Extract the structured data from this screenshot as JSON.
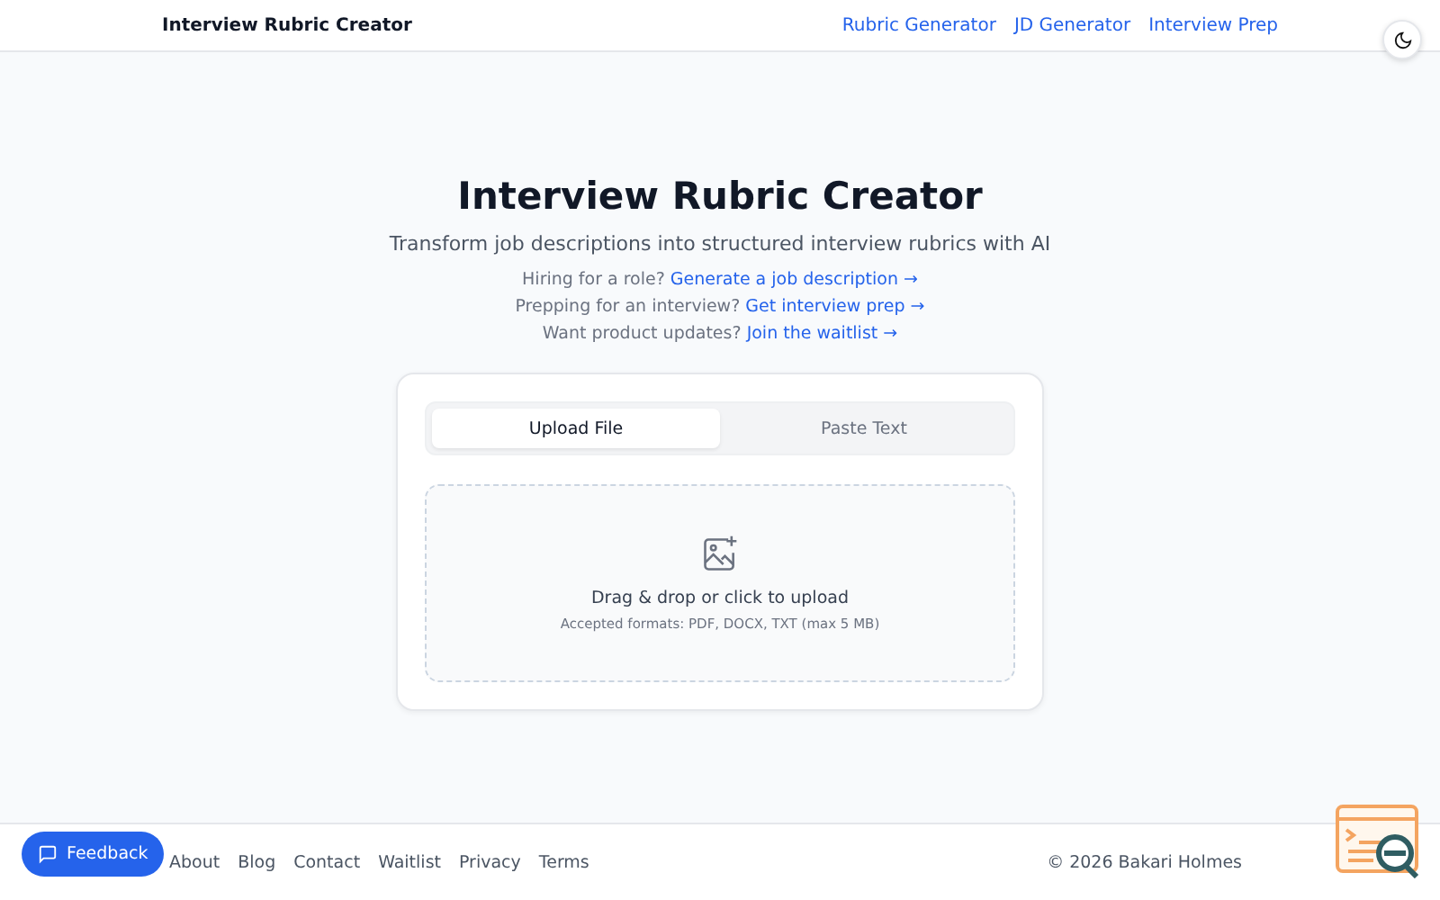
{
  "header": {
    "brand": "Interview Rubric Creator",
    "nav": [
      "Rubric Generator",
      "JD Generator",
      "Interview Prep"
    ]
  },
  "hero": {
    "title": "Interview Rubric Creator",
    "subtitle": "Transform job descriptions into structured interview rubrics with AI",
    "promos": [
      {
        "text": "Hiring for a role?",
        "link": "Generate a job description →"
      },
      {
        "text": "Prepping for an interview?",
        "link": "Get interview prep →"
      },
      {
        "text": "Want product updates?",
        "link": "Join the waitlist →"
      }
    ]
  },
  "tabs": [
    {
      "label": "Upload File",
      "selected": true
    },
    {
      "label": "Paste Text",
      "selected": false
    }
  ],
  "dropzone": {
    "title": "Drag & drop or click to upload",
    "hint": "Accepted formats: PDF, DOCX, TXT (max 5 MB)"
  },
  "feedback_button": "Feedback",
  "footer": {
    "links": [
      "About",
      "Blog",
      "Contact",
      "Waitlist",
      "Privacy",
      "Terms"
    ],
    "copyright": "© 2026 Bakari Holmes"
  }
}
